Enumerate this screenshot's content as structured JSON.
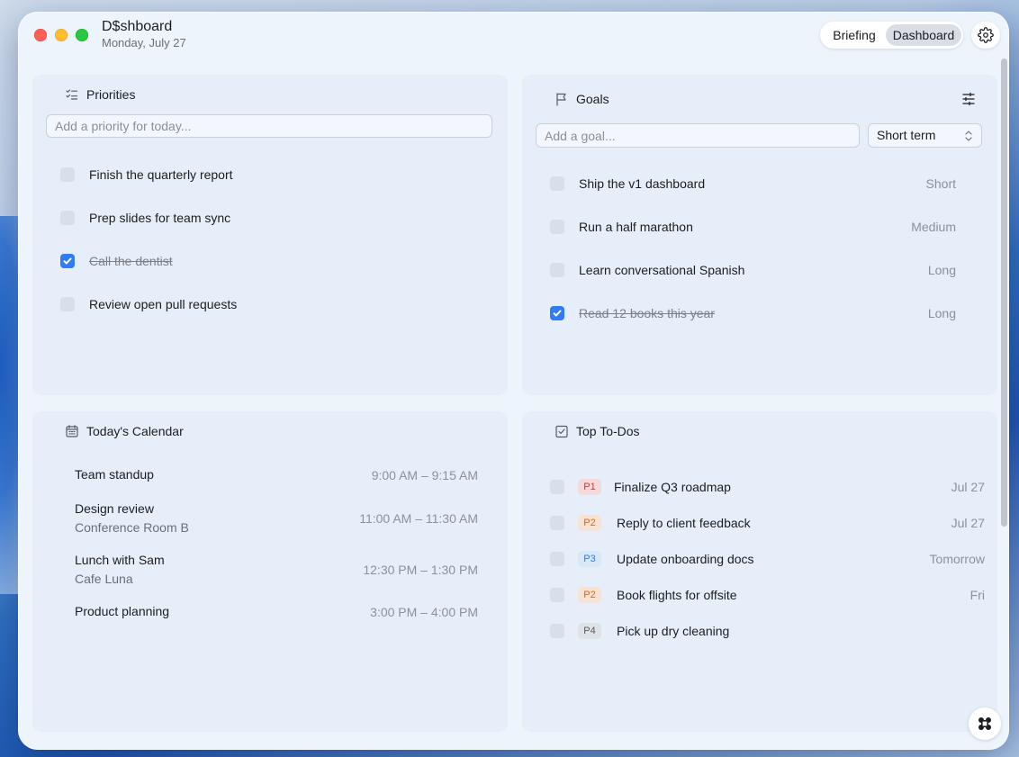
{
  "window": {
    "title": "D$shboard",
    "date": "Monday, July 27"
  },
  "header": {
    "segments": [
      {
        "label": "Briefing",
        "selected": false
      },
      {
        "label": "Dashboard",
        "selected": true
      }
    ],
    "settings_icon": "gear-icon"
  },
  "priorities": {
    "title": "Priorities",
    "icon": "checklist-icon",
    "input_placeholder": "Add a priority for today...",
    "items": [
      {
        "text": "Finish the quarterly report",
        "done": false
      },
      {
        "text": "Prep slides for team sync",
        "done": false
      },
      {
        "text": "Call the dentist",
        "done": true
      },
      {
        "text": "Review open pull requests",
        "done": false
      }
    ]
  },
  "goals": {
    "title": "Goals",
    "icon": "flag-icon",
    "filter_icon": "sliders-icon",
    "input_placeholder": "Add a goal...",
    "term_select": "Short term",
    "items": [
      {
        "text": "Ship the v1 dashboard",
        "term": "Short",
        "done": false
      },
      {
        "text": "Run a half marathon",
        "term": "Medium",
        "done": false
      },
      {
        "text": "Learn conversational Spanish",
        "term": "Long",
        "done": false
      },
      {
        "text": "Read 12 books this year",
        "term": "Long",
        "done": true
      }
    ]
  },
  "calendar": {
    "title": "Today's Calendar",
    "icon": "calendar-icon",
    "events": [
      {
        "title": "Team standup",
        "location": "",
        "time": "9:00 AM – 9:15 AM"
      },
      {
        "title": "Design review",
        "location": "Conference Room B",
        "time": "11:00 AM – 11:30 AM"
      },
      {
        "title": "Lunch with Sam",
        "location": "Cafe Luna",
        "time": "12:30 PM – 1:30 PM"
      },
      {
        "title": "Product planning",
        "location": "",
        "time": "3:00 PM – 4:00 PM"
      }
    ]
  },
  "todos": {
    "title": "Top To-Dos",
    "icon": "checkbox-icon",
    "items": [
      {
        "priority": "P1",
        "text": "Finalize Q3 roadmap",
        "due": "Jul 27"
      },
      {
        "priority": "P2",
        "text": "Reply to client feedback",
        "due": "Jul 27"
      },
      {
        "priority": "P3",
        "text": "Update onboarding docs",
        "due": "Tomorrow"
      },
      {
        "priority": "P2",
        "text": "Book flights for offsite",
        "due": "Fri"
      },
      {
        "priority": "P4",
        "text": "Pick up dry cleaning",
        "due": ""
      }
    ]
  },
  "fab_icon": "command-icon",
  "colors": {
    "accent": "#2f7cf6",
    "p1": "#c9393a",
    "p2": "#d46a23",
    "p3": "#2d7ed4",
    "p4": "#555b63"
  }
}
